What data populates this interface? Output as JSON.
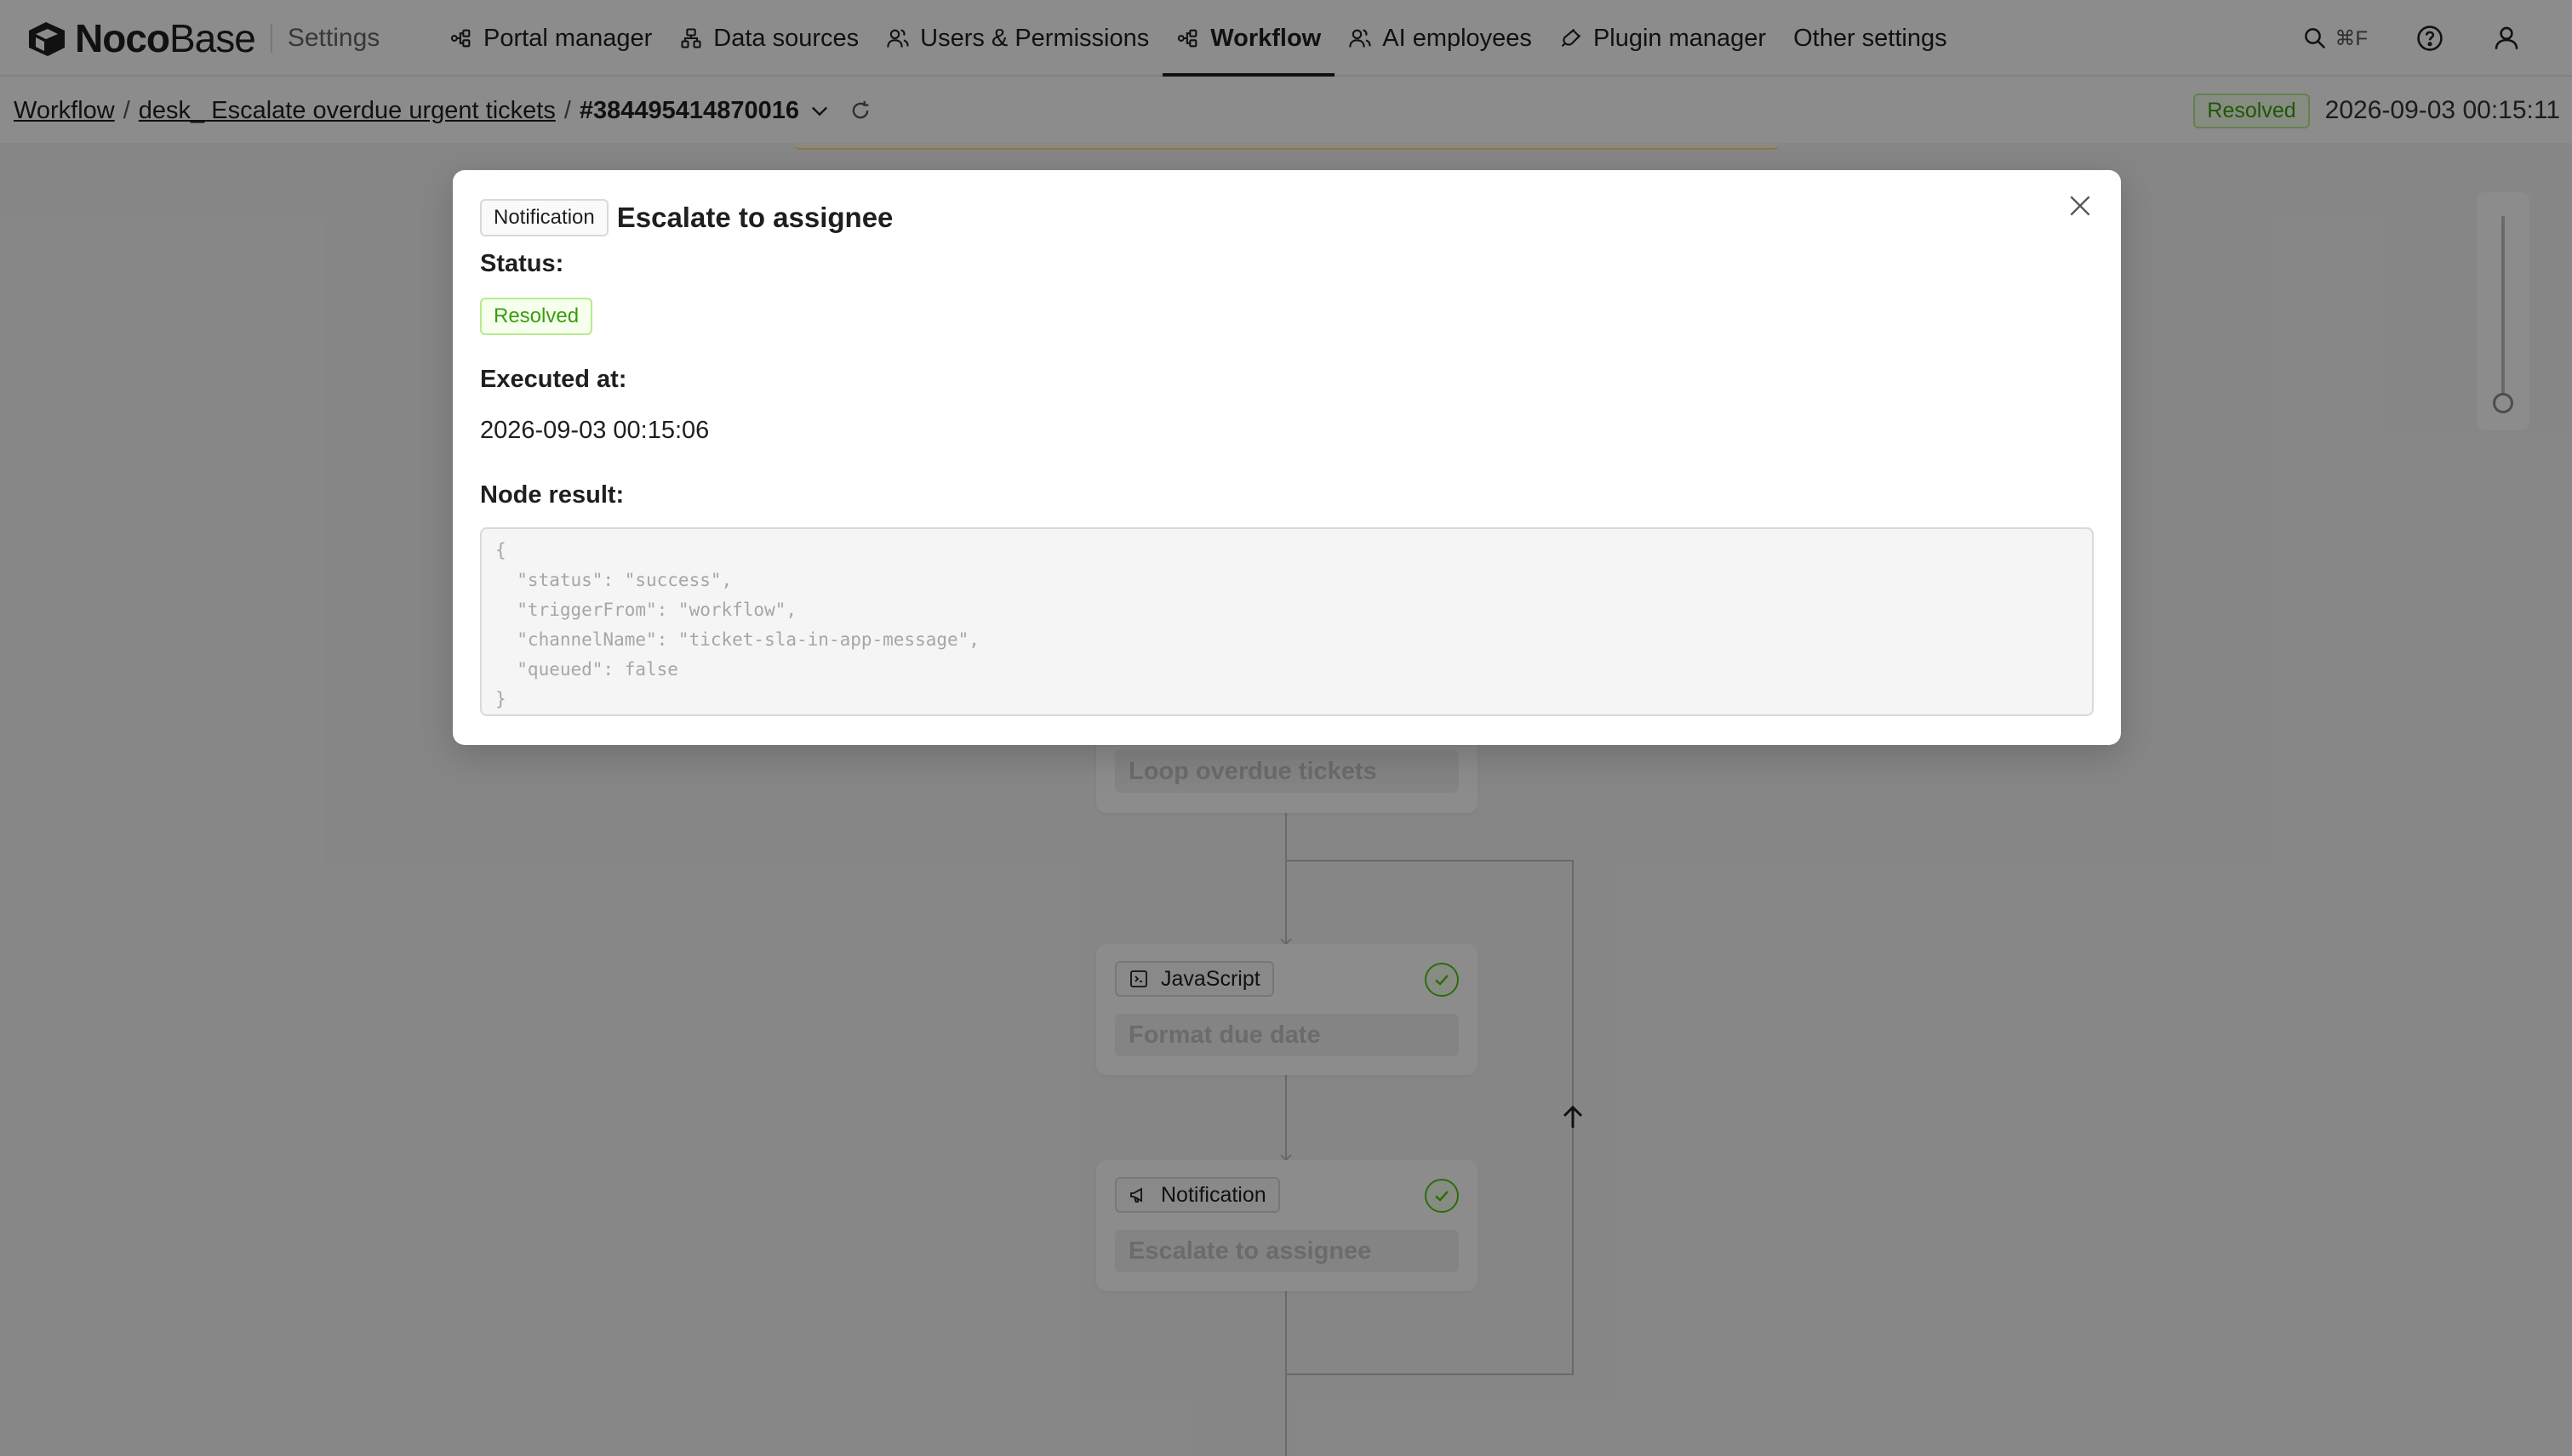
{
  "app": {
    "logo_strong": "Noco",
    "logo_light": "Base",
    "section": "Settings"
  },
  "nav": {
    "items": [
      {
        "label": "Portal manager",
        "icon": "portal-icon"
      },
      {
        "label": "Data sources",
        "icon": "database-icon"
      },
      {
        "label": "Users & Permissions",
        "icon": "users-icon"
      },
      {
        "label": "Workflow",
        "icon": "workflow-icon",
        "active": true
      },
      {
        "label": "AI employees",
        "icon": "ai-employee-icon"
      },
      {
        "label": "Plugin manager",
        "icon": "plugin-icon"
      },
      {
        "label": "Other settings",
        "icon": ""
      }
    ],
    "search_shortcut": "⌘F"
  },
  "breadcrumb": {
    "root": "Workflow",
    "workflow_name": "desk_ Escalate overdue urgent tickets",
    "separator": "/",
    "execution_id": "#384495414870016",
    "status": "Resolved",
    "timestamp": "2026-09-03 00:15:11"
  },
  "canvas": {
    "nodes": [
      {
        "type": "",
        "title": "Loop overdue tickets",
        "icon": "loop-icon"
      },
      {
        "type": "JavaScript",
        "title": "Format due date",
        "icon": "code-icon"
      },
      {
        "type": "Notification",
        "title": "Escalate to assignee",
        "icon": "megaphone-icon"
      }
    ]
  },
  "modal": {
    "tag": "Notification",
    "title": "Escalate to assignee",
    "status_label": "Status:",
    "status_value": "Resolved",
    "executed_label": "Executed at:",
    "executed_value": "2026-09-03 00:15:06",
    "result_label": "Node result:",
    "result_json": "{\n  \"status\": \"success\",\n  \"triggerFrom\": \"workflow\",\n  \"channelName\": \"ticket-sla-in-app-message\",\n  \"queued\": false\n}"
  },
  "colors": {
    "success": "#52c41a",
    "success_bg": "#f6ffed",
    "success_text": "#389e0d",
    "overlay": "rgba(0,0,0,0.45)"
  }
}
